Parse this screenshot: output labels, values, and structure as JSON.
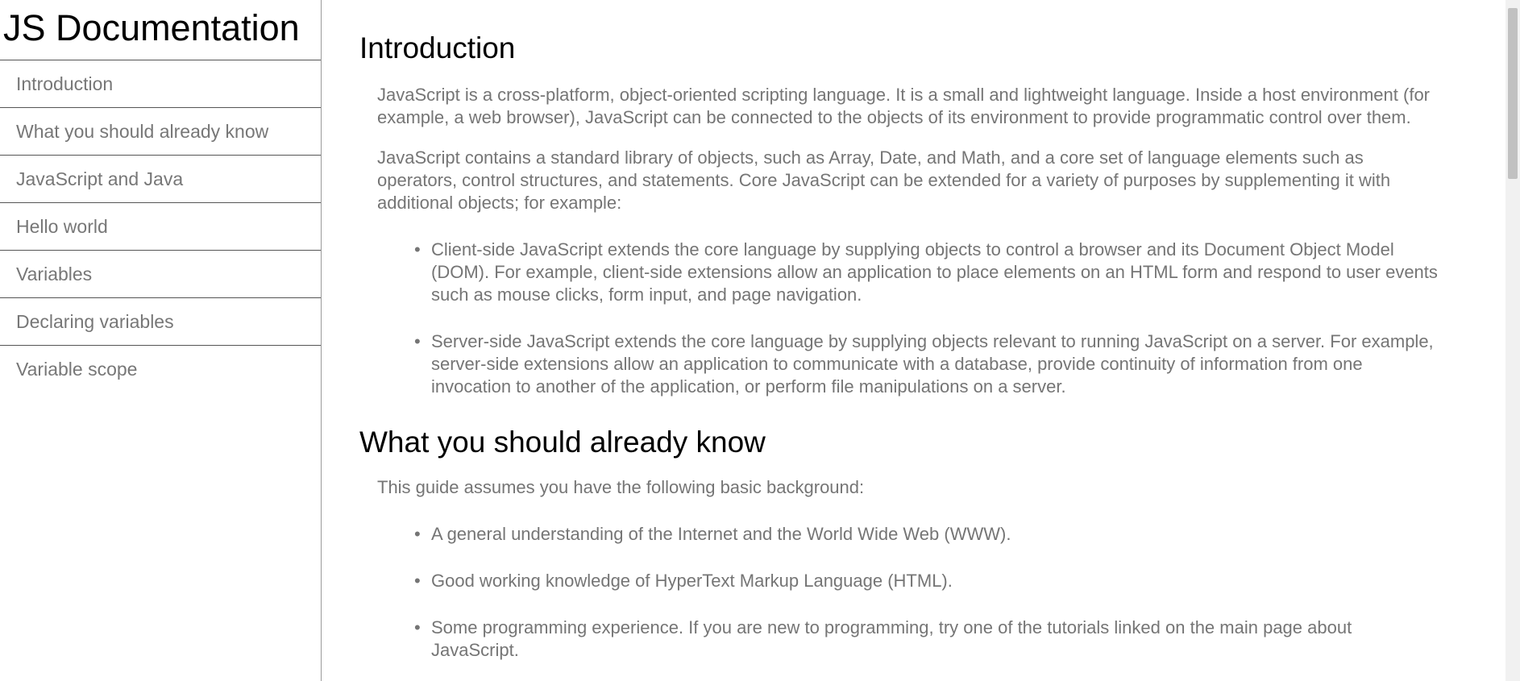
{
  "navbar": {
    "title": "JS Documentation",
    "items": [
      {
        "label": "Introduction"
      },
      {
        "label": "What you should already know"
      },
      {
        "label": "JavaScript and Java"
      },
      {
        "label": "Hello world"
      },
      {
        "label": "Variables"
      },
      {
        "label": "Declaring variables"
      },
      {
        "label": "Variable scope"
      }
    ]
  },
  "main": {
    "introduction": {
      "title": "Introduction",
      "paragraphs": [
        "JavaScript is a cross-platform, object-oriented scripting language. It is a small and lightweight language. Inside a host environment (for example, a web browser), JavaScript can be connected to the objects of its environment to provide programmatic control over them.",
        "JavaScript contains a standard library of objects, such as Array, Date, and Math, and a core set of language elements such as operators, control structures, and statements. Core JavaScript can be extended for a variety of purposes by supplementing it with additional objects; for example:"
      ],
      "bullets": [
        "Client-side JavaScript extends the core language by supplying objects to control a browser and its Document Object Model (DOM). For example, client-side extensions allow an application to place elements on an HTML form and respond to user events such as mouse clicks, form input, and page navigation.",
        "Server-side JavaScript extends the core language by supplying objects relevant to running JavaScript on a server. For example, server-side extensions allow an application to communicate with a database, provide continuity of information from one invocation to another of the application, or perform file manipulations on a server."
      ]
    },
    "what_you_should_know": {
      "title": "What you should already know",
      "paragraph": "This guide assumes you have the following basic background:",
      "bullets": [
        "A general understanding of the Internet and the World Wide Web (WWW).",
        "Good working knowledge of HyperText Markup Language (HTML).",
        "Some programming experience. If you are new to programming, try one of the tutorials linked on the main page about JavaScript."
      ]
    }
  },
  "bullet_glyph": "•"
}
